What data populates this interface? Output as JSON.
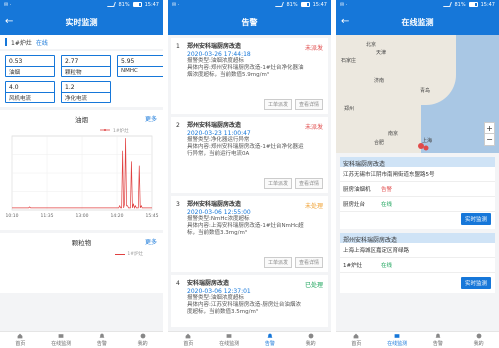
{
  "colors": {
    "primary": "#1677d9",
    "alarm_new": "#e04b4b",
    "alarm_processing": "#f0a030",
    "alarm_done": "#1aa35a",
    "series": "#e04040"
  },
  "status_bar": {
    "signal": "✉ ⋅",
    "battery": "81%",
    "time": "15:47"
  },
  "tabs": [
    {
      "label": "首页",
      "icon": "home-icon"
    },
    {
      "label": "在线监测",
      "icon": "monitor-icon"
    },
    {
      "label": "告警",
      "icon": "bell-icon"
    },
    {
      "label": "我的",
      "icon": "user-icon"
    }
  ],
  "screen1": {
    "title": "实时监测",
    "device": {
      "name": "1#炉灶",
      "status": "在线"
    },
    "metrics": [
      {
        "value": "0.53",
        "label": "油烟"
      },
      {
        "value": "2.77",
        "label": "颗粒物"
      },
      {
        "value": "5.95",
        "label": "NMHC"
      },
      {
        "value": "4.0",
        "label": "风机电流"
      },
      {
        "value": "1.2",
        "label": "净化电流"
      }
    ],
    "chart_title": "油烟",
    "chart2_title": "颗粒物",
    "more_label": "更多",
    "legend": "1#炉灶"
  },
  "chart_data": [
    {
      "type": "line",
      "title": "油烟",
      "series": [
        {
          "name": "1#炉灶",
          "values": [
            0.1,
            0.1,
            0.1,
            0.1,
            0.1,
            0.1,
            0.1,
            0.1,
            0.1,
            0.1,
            0.1,
            0.1,
            0.1,
            0.1,
            0.1,
            0.1,
            0.1,
            0.1,
            0.15,
            0.1,
            0.1,
            0.1,
            0.1,
            0.1,
            0.1,
            0.1,
            0.1,
            0.1,
            0.1,
            0.1,
            0.1,
            0.1,
            0.1,
            0.1,
            0.1,
            0.1,
            0.1,
            0.1,
            0.1,
            0.1,
            0.1,
            0.1,
            0.1,
            0.1,
            0.1,
            0.1,
            0.1,
            0.1,
            0.1,
            0.1,
            0.1,
            0.1,
            0.1,
            0.1,
            0.1,
            0.1,
            0.1,
            0.1,
            0.1,
            0.1,
            0.1,
            0.1,
            0.1,
            0.1,
            0.1,
            0.1,
            0.1,
            0.1,
            0.1,
            0.1,
            0.1,
            0.1,
            0.1,
            0.1,
            0.1,
            0.1,
            0.1,
            0.1,
            0.1,
            0.1,
            0.1,
            0.1,
            0.1,
            0.1,
            0.1,
            0.1,
            0.1,
            0.1,
            0.1,
            0.1,
            0.1,
            0.1,
            0.1,
            0.1,
            0.1,
            0.1,
            0.1,
            0.1,
            0.1,
            0.1,
            0.1,
            0.1,
            0.1,
            0.1,
            0.1,
            0.1,
            0.1,
            0.1,
            0.1,
            0.1,
            0.2,
            0.1,
            0.1,
            2.8,
            0.1,
            0.3,
            3.4,
            0.2,
            0.2,
            0.1,
            0.1,
            0.1,
            2.3,
            0.1,
            0.3,
            0.1,
            0.2,
            0.1,
            0.1,
            0.1,
            2.1,
            0.1,
            0.2,
            0.1,
            0.1,
            0.1,
            0.1,
            0.1,
            0.1,
            0.1,
            0.1,
            0.1,
            0.1,
            0.1
          ]
        }
      ],
      "x_ticks": [
        "10:10",
        "11:35",
        "13:00",
        "14:20",
        "15:45"
      ],
      "ylim": [
        0,
        3.5
      ],
      "grid": true
    }
  ],
  "screen2": {
    "title": "告警",
    "alarms": [
      {
        "num": "1",
        "title": "郑州安科瑞厨房改造",
        "status": "未派发",
        "state": "new",
        "date": "2020-03-26 17:44:18",
        "lines": [
          "报警类型:油烟浓度超标",
          "具体内容:郑州安科瑞厨房改造-1#灶台净化器油",
          "烟浓度超标，当前数值5.9mg/m³"
        ],
        "buttons": [
          "工单派发",
          "查看详情"
        ]
      },
      {
        "num": "2",
        "title": "郑州安科瑞厨房改造",
        "status": "未派发",
        "state": "new",
        "date": "2020-03-23 11:00:47",
        "lines": [
          "报警类型:净化器运行异常",
          "具体内容:郑州安科瑞厨房改造-1#灶台净化器运",
          "行异常，当前运行电流0A"
        ],
        "buttons": [
          "工单派发",
          "查看详情"
        ]
      },
      {
        "num": "3",
        "title": "郑州安科瑞厨房改造",
        "status": "未处理",
        "state": "proc",
        "date": "2020-03-06 12:55:00",
        "lines": [
          "报警类型:NmHc浓度超标",
          "具体内容:上海安科瑞厨房改造-1#灶台NmHc超",
          "标，当前数值3.3mg/m³"
        ],
        "buttons": [
          "工单派发",
          "查看详情"
        ]
      },
      {
        "num": "4",
        "title": "安科瑞厨房改造",
        "status": "已处理",
        "state": "done",
        "date": "2020-03-06 12:37:01",
        "lines": [
          "报警类型:油烟浓度超标",
          "具体内容:江苏安科瑞厨房改造-厨房灶台油烟浓",
          "度超标，当前数值3.5mg/m³"
        ],
        "buttons": []
      }
    ]
  },
  "screen3": {
    "title": "在线监测",
    "map_labels": [
      "北京",
      "天津",
      "石家庄",
      "济南",
      "郑州",
      "南京",
      "合肥",
      "上海",
      "青岛"
    ],
    "zoom_in": "+",
    "zoom_out": "−",
    "card1": {
      "head": "安科瑞厨房改造",
      "address": "江苏无锡市江阴市南闸街道东盟路5号",
      "rows": [
        {
          "k": "厨房油烟机",
          "v": "告警",
          "type": "alarm"
        },
        {
          "k": "厨房灶台",
          "v": "在线",
          "type": "online"
        }
      ],
      "button": "实时监测"
    },
    "card2": {
      "head": "郑州安科瑞厨房改造",
      "address": "上海上海城区嘉定区育绿路",
      "rows": [
        {
          "k": "1#炉灶",
          "v": "在线",
          "type": "online"
        }
      ],
      "button": "实时监测"
    }
  }
}
